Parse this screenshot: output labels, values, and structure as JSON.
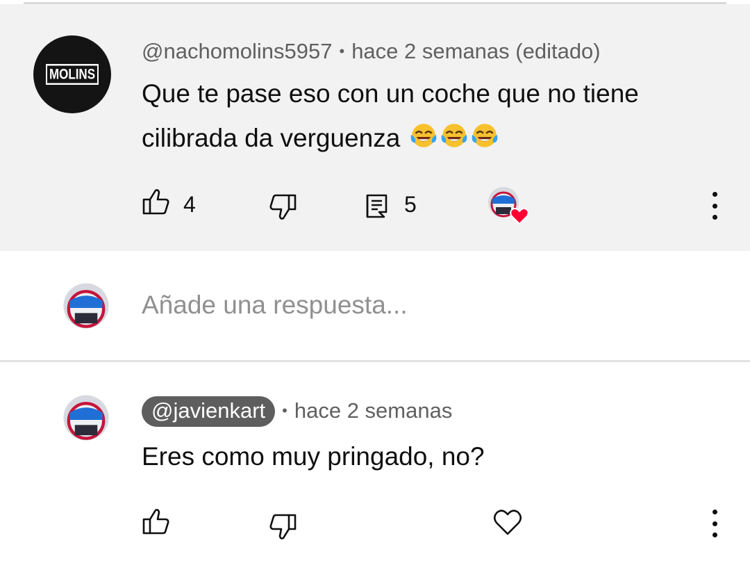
{
  "comment": {
    "author": "@nachomolins5957",
    "time": "hace 2 semanas (editado)",
    "text_line1": "Que te pase eso con un coche que no tiene",
    "text_line2": "cilibrada da verguenza",
    "avatar_logo_text": "MOLINS",
    "likes": "4",
    "replies": "5",
    "emojis": [
      "face-with-tears-of-joy",
      "face-with-tears-of-joy",
      "face-with-tears-of-joy"
    ]
  },
  "reply_box": {
    "placeholder": "Añade una respuesta..."
  },
  "reply": {
    "author": "@javienkart",
    "time": "hace 2 semanas",
    "text": "Eres como muy pringado, no?"
  },
  "colors": {
    "comment_bg": "#f2f2f2",
    "meta_text": "#606060",
    "placeholder_text": "#909090",
    "heart_red": "#ff0033",
    "author_pill": "#5e5e5e"
  },
  "icons": [
    "thumb-up-icon",
    "thumb-down-icon",
    "reply-icon",
    "creator-heart-icon",
    "more-vert-icon",
    "heart-outline-icon"
  ]
}
